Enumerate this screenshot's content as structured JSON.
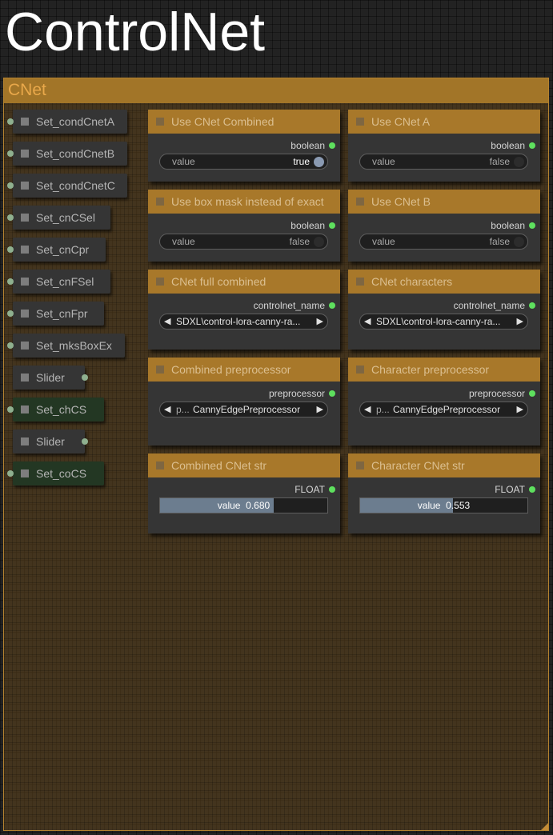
{
  "title": "ControlNet",
  "group": {
    "title": "CNet"
  },
  "side_nodes": [
    {
      "label": "Set_condCnetA",
      "color": "gray"
    },
    {
      "label": "Set_condCnetB",
      "color": "gray"
    },
    {
      "label": "Set_condCnetC",
      "color": "gray"
    },
    {
      "label": "Set_cnCSel",
      "color": "gray"
    },
    {
      "label": "Set_cnCpr",
      "color": "gray"
    },
    {
      "label": "Set_cnFSel",
      "color": "gray"
    },
    {
      "label": "Set_cnFpr",
      "color": "gray"
    },
    {
      "label": "Set_mksBoxEx",
      "color": "gray"
    },
    {
      "label": "Slider",
      "color": "gray"
    },
    {
      "label": "Set_chCS",
      "color": "green"
    },
    {
      "label": "Slider",
      "color": "gray"
    },
    {
      "label": "Set_coCS",
      "color": "green"
    }
  ],
  "nodes": {
    "use_cnet_combined": {
      "title": "Use CNet Combined",
      "output": "boolean",
      "widget_label": "value",
      "widget_value": "true"
    },
    "use_cnet_a": {
      "title": "Use CNet A",
      "output": "boolean",
      "widget_label": "value",
      "widget_value": "false"
    },
    "use_box_mask": {
      "title": "Use box mask instead of exact",
      "output": "boolean",
      "widget_label": "value",
      "widget_value": "false"
    },
    "use_cnet_b": {
      "title": "Use CNet B",
      "output": "boolean",
      "widget_label": "value",
      "widget_value": "false"
    },
    "cnet_full_combined": {
      "title": "CNet full combined",
      "output": "controlnet_name",
      "combo_value": "SDXL\\control-lora-canny-ra..."
    },
    "cnet_characters": {
      "title": "CNet characters",
      "output": "controlnet_name",
      "combo_value": "SDXL\\control-lora-canny-ra..."
    },
    "combined_preprocessor": {
      "title": "Combined preprocessor",
      "output": "preprocessor",
      "combo_label": "p...",
      "combo_value": "CannyEdgePreprocessor"
    },
    "character_preprocessor": {
      "title": "Character preprocessor",
      "output": "preprocessor",
      "combo_label": "p...",
      "combo_value": "CannyEdgePreprocessor"
    },
    "combined_cnet_str": {
      "title": "Combined CNet str",
      "output": "FLOAT",
      "slider_label": "value",
      "slider_value": "0.680",
      "fill": 0.68
    },
    "character_cnet_str": {
      "title": "Character CNet str",
      "output": "FLOAT",
      "slider_label": "value",
      "slider_value": "0.553",
      "fill": 0.553
    }
  },
  "arrows": {
    "left": "◀",
    "right": "▶"
  },
  "colors": {
    "node_header": "#a8782a",
    "group_border": "#b5832f",
    "output_dot": "#5ee05e"
  }
}
